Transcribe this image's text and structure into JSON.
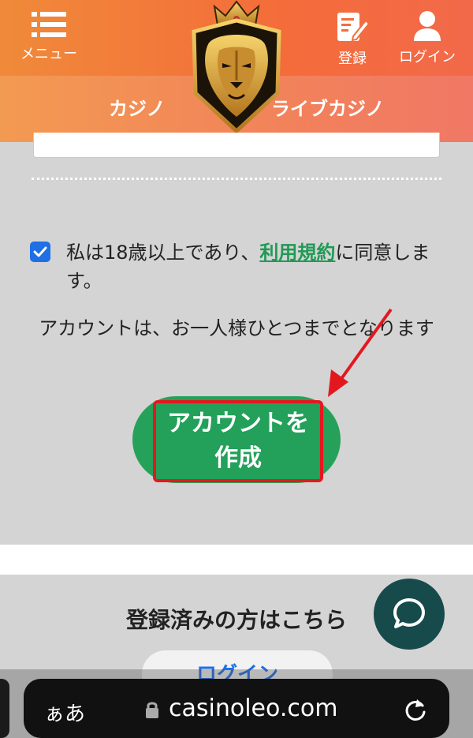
{
  "header": {
    "menu_label": "メニュー",
    "register_label": "登録",
    "login_label": "ログイン",
    "tab_casino": "カジノ",
    "tab_live_casino": "ライブカジノ"
  },
  "form": {
    "age_check_before": "私は18歳以上であり、",
    "terms_link": "利用規約",
    "age_check_after": "に同意します。",
    "one_account_notice": "アカウントは、お一人様ひとつまでとなります",
    "create_account_button": "アカウントを作成"
  },
  "lower": {
    "registered_title": "登録済みの方はこちら",
    "login_button": "ログイン"
  },
  "browser": {
    "aa_label": "ぁあ",
    "domain": "casinoleo.com"
  },
  "colors": {
    "header_orange": "#f46c3a",
    "button_green": "#23a059",
    "highlight_red": "#e3181e",
    "link_green": "#1f9a55",
    "chat_teal": "#174a4b"
  }
}
